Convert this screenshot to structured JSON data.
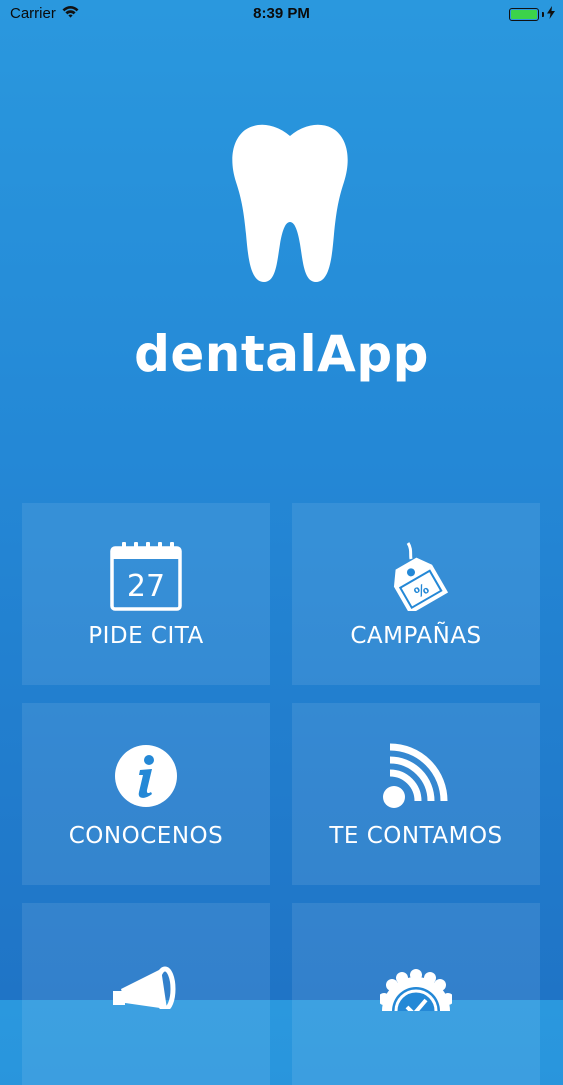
{
  "status_bar": {
    "carrier": "Carrier",
    "time": "8:39 PM",
    "icons": [
      "wifi-icon",
      "battery-icon",
      "charging-bolt-icon"
    ]
  },
  "app": {
    "title": "dentalApp",
    "logo_icon": "tooth-icon"
  },
  "calendar_day": "27",
  "menu": [
    {
      "label": "PIDE CITA",
      "icon": "calendar-icon"
    },
    {
      "label": "CAMPAÑAS",
      "icon": "discount-tag-icon"
    },
    {
      "label": "CONOCENOS",
      "icon": "info-icon"
    },
    {
      "label": "TE CONTAMOS",
      "icon": "rss-feed-icon"
    },
    {
      "label": "",
      "icon": "megaphone-icon"
    },
    {
      "label": "",
      "icon": "quality-badge-icon"
    }
  ],
  "colors": {
    "background_top": "#2a98de",
    "background_bottom": "#1f74c6",
    "tile": "rgba(255,255,255,0.09)",
    "foreground": "#ffffff",
    "battery": "#3cd34a"
  }
}
